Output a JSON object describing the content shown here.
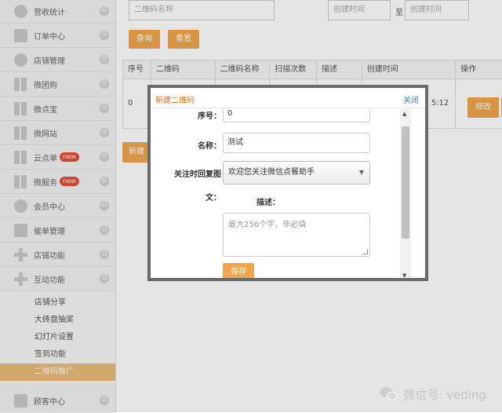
{
  "sidebar": {
    "items": [
      {
        "label": "营收统计",
        "icon": "pie-chart-icon"
      },
      {
        "label": "订单中心",
        "icon": "printer-icon"
      },
      {
        "label": "店铺管理",
        "icon": "pie-chart-icon"
      },
      {
        "label": "微团购",
        "icon": "grid-icon"
      },
      {
        "label": "微点宝",
        "icon": "grid-icon"
      },
      {
        "label": "微网站",
        "icon": "grid-icon"
      },
      {
        "label": "云点单",
        "icon": "grid-icon",
        "badge": "new"
      },
      {
        "label": "微服务",
        "icon": "grid-icon",
        "badge": "new"
      },
      {
        "label": "会员中心",
        "icon": "pie-chart-icon"
      },
      {
        "label": "催单管理",
        "icon": "printer-icon"
      },
      {
        "label": "店铺功能",
        "icon": "plus-icon"
      },
      {
        "label": "互动功能",
        "icon": "plus-icon"
      }
    ],
    "subitems": [
      "店铺分享",
      "大砖盘抽奖",
      "幻灯片设置",
      "签到功能",
      "二维码推广"
    ],
    "bottom_item": {
      "label": "顾客中心",
      "icon": "printer-icon"
    }
  },
  "filters": {
    "name_placeholder": "二维码名称",
    "date_from_placeholder": "创建时间",
    "date_to_placeholder": "创建时间",
    "to_label": "至",
    "query_label": "查询",
    "reset_label": "重置"
  },
  "table": {
    "headers": [
      "序号",
      "二维码",
      "二维码名称",
      "扫描次数",
      "描述",
      "创建时间",
      "操作"
    ],
    "row": {
      "index": "0",
      "time": "5:12",
      "edit_label": "修改"
    },
    "new_label": "新建"
  },
  "modal": {
    "title": "新建二维码",
    "close_label": "关闭",
    "index_label": "序号：",
    "index_value": "0",
    "name_label": "名称：",
    "name_value": "测试",
    "reply_label_1": "关注时回复图",
    "reply_label_2": "文：",
    "reply_value": "欢迎您关注微信点餐助手",
    "desc_label": "描述：",
    "desc_placeholder": "最大256个字，非必填",
    "save_label": "保存"
  },
  "watermark": {
    "text": "微信号: veding",
    "icon": "wechat-icon"
  },
  "colors": {
    "accent": "#f0a64c",
    "title": "#e46b1a",
    "link": "#3d86c6",
    "active_sub": "#e8bd79"
  }
}
